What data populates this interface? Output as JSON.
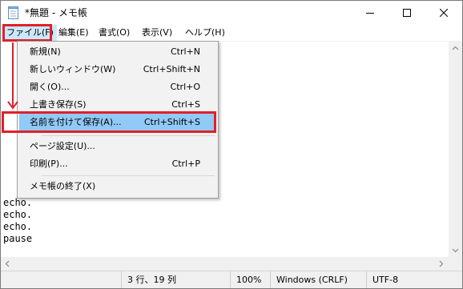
{
  "window": {
    "title": "*無題 - メモ帳",
    "controls": {
      "minimize_icon": "minimize-icon",
      "maximize_icon": "maximize-icon",
      "close_icon": "close-icon"
    }
  },
  "menubar": {
    "items": [
      {
        "label": "ファイル(F)"
      },
      {
        "label": "編集(E)"
      },
      {
        "label": "書式(O)"
      },
      {
        "label": "表示(V)"
      },
      {
        "label": "ヘルプ(H)"
      }
    ]
  },
  "file_menu": {
    "items": [
      {
        "label": "新規(N)",
        "shortcut": "Ctrl+N"
      },
      {
        "label": "新しいウィンドウ(W)",
        "shortcut": "Ctrl+Shift+N"
      },
      {
        "label": "開く(O)...",
        "shortcut": "Ctrl+O"
      },
      {
        "label": "上書き保存(S)",
        "shortcut": "Ctrl+S"
      },
      {
        "label": "名前を付けて保存(A)...",
        "shortcut": "Ctrl+Shift+S"
      },
      {
        "label": "ページ設定(U)...",
        "shortcut": ""
      },
      {
        "label": "印刷(P)...",
        "shortcut": "Ctrl+P"
      },
      {
        "label": "メモ帳の終了(X)",
        "shortcut": ""
      }
    ]
  },
  "editor": {
    "lines": [
      "echo.",
      "echo.",
      "echo.",
      "pause"
    ]
  },
  "statusbar": {
    "position": "3 行、19 列",
    "zoom": "100%",
    "line_ending": "Windows (CRLF)",
    "encoding": "UTF-8"
  },
  "colors": {
    "highlight_red": "#e0202a",
    "menu_selected": "#91c9f7",
    "menubar_active": "#cce8ff"
  }
}
